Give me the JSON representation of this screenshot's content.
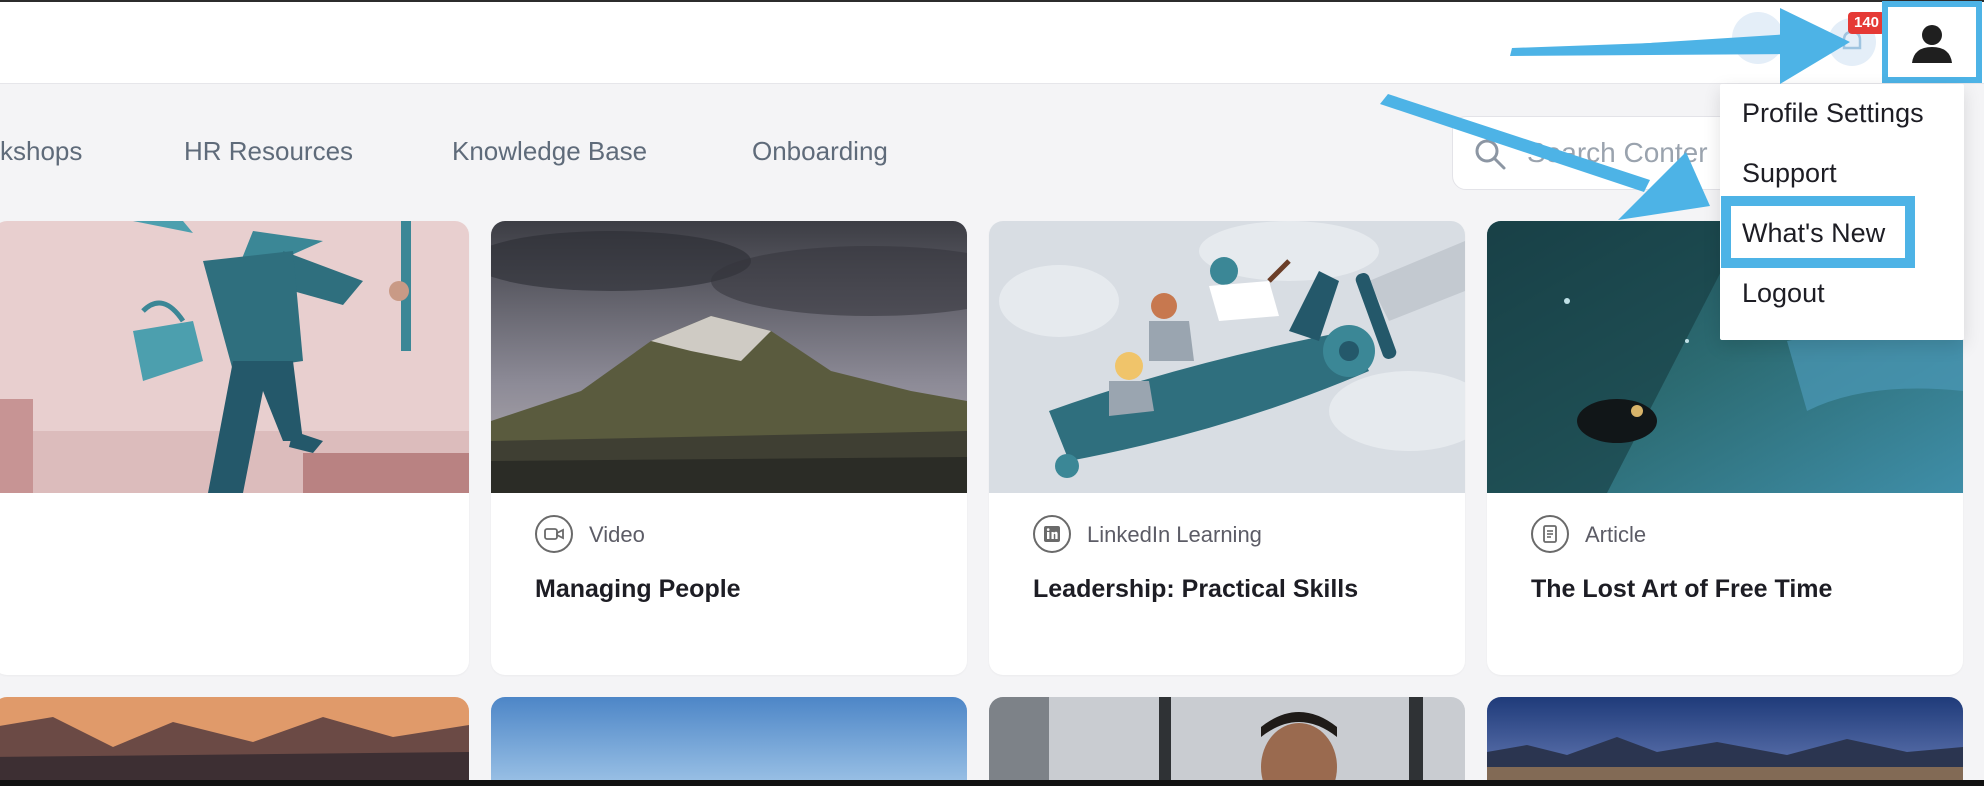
{
  "nav": {
    "items": [
      "kshops",
      "HR Resources",
      "Knowledge Base",
      "Onboarding"
    ]
  },
  "search": {
    "placeholder": "Search Conter"
  },
  "header": {
    "notification_count": "140"
  },
  "dropdown": {
    "items": [
      "Profile Settings",
      "Support",
      "What's New",
      "Logout"
    ]
  },
  "cards": [
    {
      "type": "",
      "title": ""
    },
    {
      "type": "Video",
      "title": "Managing People",
      "icon": "video-icon"
    },
    {
      "type": "LinkedIn Learning",
      "title": "Leadership: Practical Skills",
      "icon": "linkedin-icon"
    },
    {
      "type": "Article",
      "title": "The Lost Art of Free Time",
      "icon": "article-icon"
    }
  ],
  "colors": {
    "highlight": "#4db3e6",
    "badge": "#e53935",
    "teal": "#2f6f7e"
  }
}
